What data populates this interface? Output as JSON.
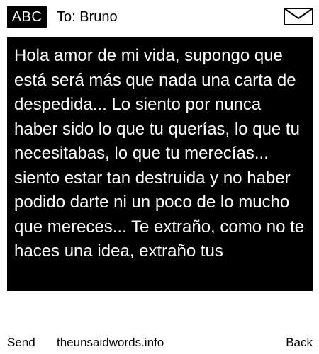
{
  "header": {
    "mode_badge": "ABC",
    "recipient_label": "To: Bruno",
    "icon": "envelope-icon"
  },
  "message": {
    "text": "Hola amor de mi vida, supongo que está será más que nada una carta de despedida... Lo siento por nunca haber sido lo que tu querías, lo que tu necesitabas, lo que tu merecías... siento estar tan destruida y no haber podido darte ni un poco de lo mucho que mereces... Te extraño, como no te haces una idea, extraño tus"
  },
  "softkeys": {
    "left": "Send",
    "center": "theunsaidwords.info",
    "right": "Back"
  },
  "colors": {
    "background": "#ffffff",
    "message_background": "#000000",
    "message_text": "#ffffff",
    "badge_background": "#000000",
    "badge_text": "#ffffff"
  }
}
